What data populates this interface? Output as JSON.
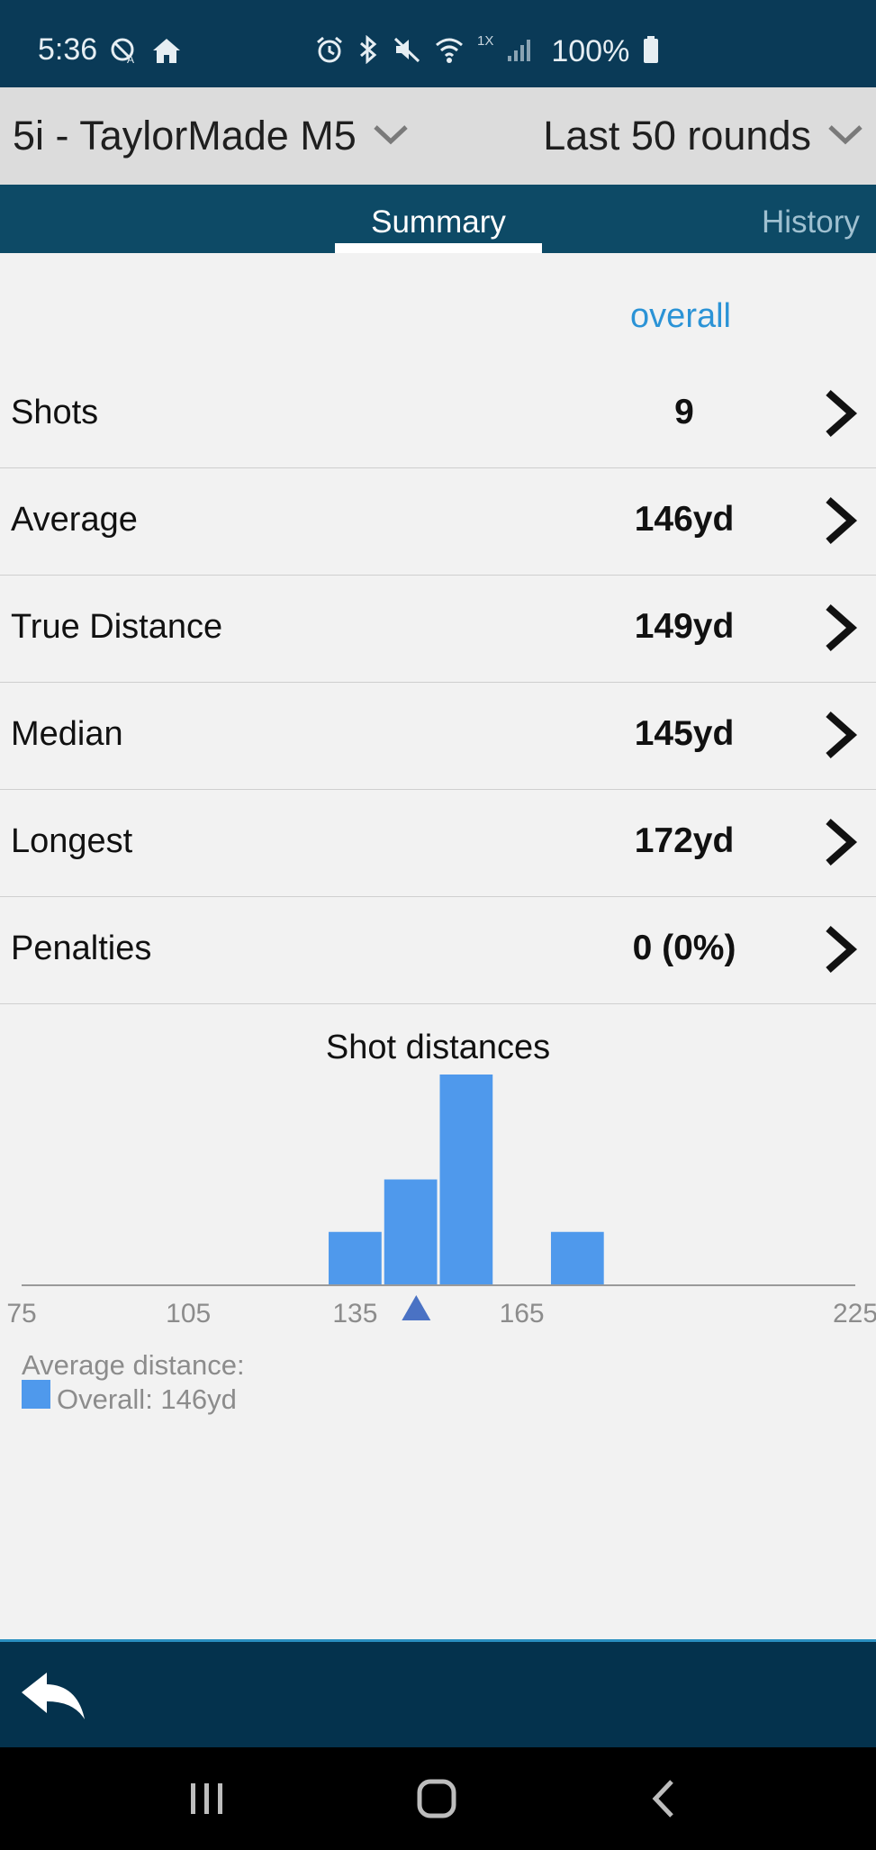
{
  "status": {
    "time": "5:36",
    "network_label": "1X",
    "battery": "100%",
    "left_icons": [
      "auto-brightness-icon",
      "home-icon"
    ],
    "right_icons": [
      "alarm-icon",
      "bluetooth-icon",
      "mute-icon",
      "wifi-icon",
      "signal-icon",
      "battery-icon"
    ]
  },
  "selector": {
    "club": "5i - TaylorMade M5",
    "range": "Last 50 rounds"
  },
  "tabs": [
    {
      "label": "Summary",
      "active": true
    },
    {
      "label": "History",
      "active": false
    }
  ],
  "column_header": "overall",
  "stats": [
    {
      "label": "Shots",
      "value": "9"
    },
    {
      "label": "Average",
      "value": "146yd"
    },
    {
      "label": "True Distance",
      "value": "149yd"
    },
    {
      "label": "Median",
      "value": "145yd"
    },
    {
      "label": "Longest",
      "value": "172yd"
    },
    {
      "label": "Penalties",
      "value": "0 (0%)"
    }
  ],
  "chart_data": {
    "type": "bar",
    "title": "Shot distances",
    "xlim": [
      75,
      225
    ],
    "x_ticks": [
      "75",
      "105",
      "135",
      "165",
      "225"
    ],
    "bin_width": 10,
    "bars": [
      {
        "x_start": 130,
        "x_end": 140,
        "count": 1
      },
      {
        "x_start": 140,
        "x_end": 150,
        "count": 2
      },
      {
        "x_start": 150,
        "x_end": 160,
        "count": 4
      },
      {
        "x_start": 170,
        "x_end": 180,
        "count": 1
      }
    ],
    "average_marker": 146,
    "bar_color": "#4f99ec",
    "marker_color": "#4a72c4",
    "legend": {
      "title": "Average distance:",
      "entry": "Overall: 146yd"
    }
  }
}
